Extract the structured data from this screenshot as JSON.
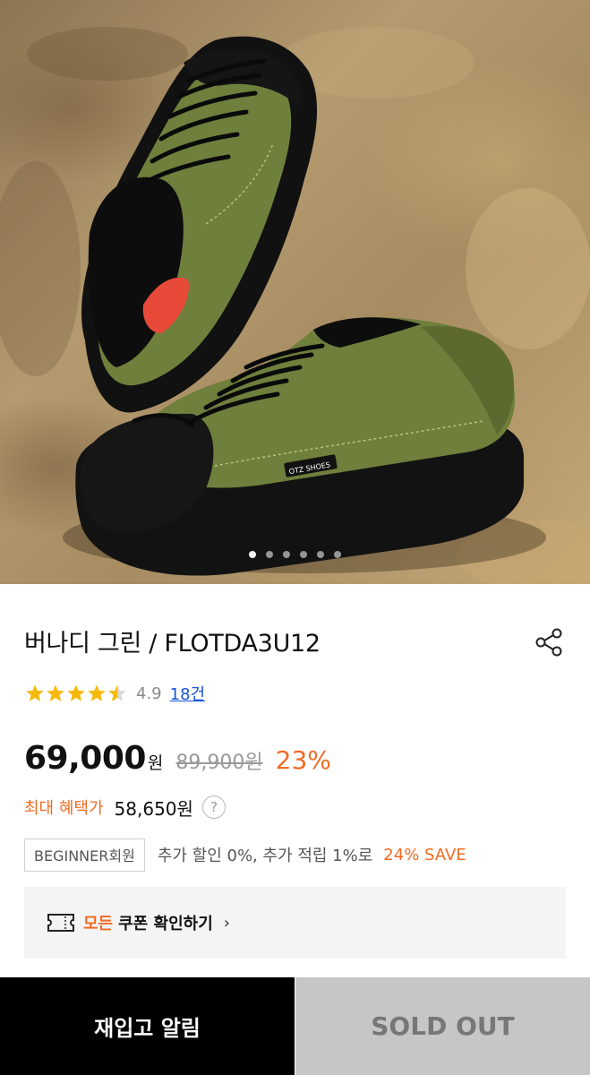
{
  "gallery": {
    "slide_count": 6,
    "active_index": 0,
    "shoe_brand_label": "OTZ SHOES"
  },
  "product": {
    "title": "버나디 그린 / FLOTDA3U12"
  },
  "rating": {
    "stars": 4.5,
    "score": "4.9",
    "reviews_link": "18건"
  },
  "price": {
    "current": "69,000",
    "currency_suffix": "원",
    "original": "89,900원",
    "discount": "23%"
  },
  "benefit": {
    "label": "최대 혜택가",
    "price": "58,650원",
    "help_symbol": "?"
  },
  "member": {
    "badge": "BEGINNER회원",
    "text": "추가 할인 0%, 추가 적립 1%로",
    "save": "24% SAVE"
  },
  "coupon": {
    "highlight": "모든",
    "rest": "쿠폰 확인하기",
    "chevron": "›"
  },
  "actions": {
    "restock_label": "재입고 알림",
    "soldout_label": "SOLD OUT"
  },
  "colors": {
    "accent_orange": "#f06b24",
    "link_blue": "#1a54d6",
    "star_yellow": "#f5b90a",
    "shoe_olive": "#6f7f3c"
  }
}
